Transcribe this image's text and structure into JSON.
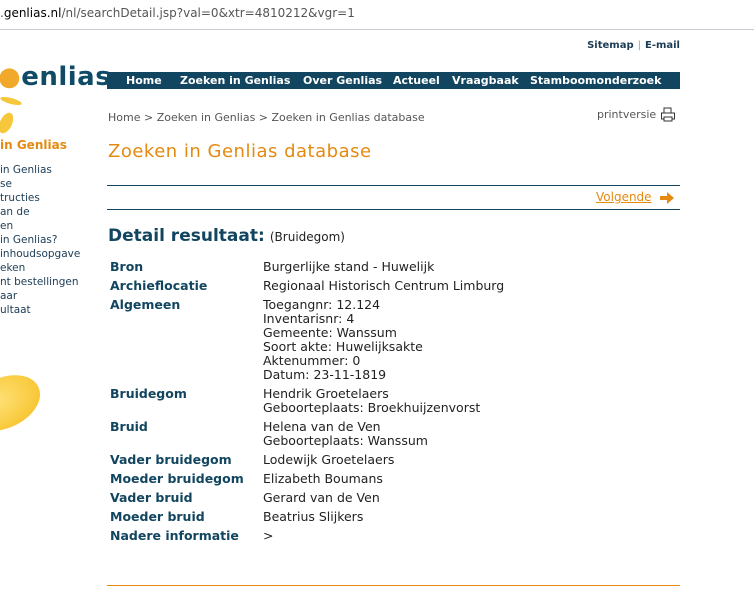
{
  "address": {
    "host": "genlias.nl",
    "prefix": ".",
    "path": "/nl/searchDetail.jsp?val=0&xtr=4810212&vgr=1"
  },
  "logo": "enlias",
  "sidebar": {
    "title": "in Genlias",
    "items": [
      "in Genlias",
      "se",
      "tructies",
      "an de",
      "en",
      "in Genlias?",
      "inhoudsopgave",
      "eken",
      "nt bestellingen",
      "aar",
      "ultaat"
    ]
  },
  "toplinks": {
    "sitemap": "Sitemap",
    "email": "E-mail"
  },
  "nav": [
    "Home",
    "Zoeken in Genlias",
    "Over Genlias",
    "Actueel",
    "Vraagbaak",
    "Stamboomonderzoek"
  ],
  "breadcrumb": "Home  >  Zoeken in Genlias  >  Zoeken in Genlias database",
  "print_label": "printversie",
  "page_title": "Zoeken in Genlias database",
  "next_label": "Volgende",
  "detail": {
    "heading": "Detail resultaat:",
    "sub": "(Bruidegom)"
  },
  "rows": [
    {
      "key": "Bron",
      "values": [
        "Burgerlijke stand - Huwelijk"
      ]
    },
    {
      "key": "Archieflocatie",
      "values": [
        "Regionaal Historisch Centrum Limburg"
      ]
    },
    {
      "key": "Algemeen",
      "values": [
        "Toegangnr: 12.124",
        "Inventarisnr: 4",
        "Gemeente: Wanssum",
        "Soort akte: Huwelijksakte",
        "Aktenummer: 0",
        "Datum: 23-11-1819"
      ]
    },
    {
      "key": "Bruidegom",
      "values": [
        "Hendrik Groetelaers",
        "Geboorteplaats: Broekhuijzenvorst"
      ]
    },
    {
      "key": "Bruid",
      "values": [
        "Helena van de Ven",
        "Geboorteplaats: Wanssum"
      ]
    },
    {
      "key": "Vader bruidegom",
      "values": [
        "Lodewijk Groetelaers"
      ]
    },
    {
      "key": "Moeder bruidegom",
      "values": [
        "Elizabeth Boumans"
      ]
    },
    {
      "key": "Vader bruid",
      "values": [
        "Gerard van de Ven"
      ]
    },
    {
      "key": "Moeder bruid",
      "values": [
        "Beatrius Slijkers"
      ]
    },
    {
      "key": "Nadere informatie",
      "values": [
        ">"
      ]
    }
  ],
  "colors": {
    "navy": "#12455f",
    "orange": "#e58a10",
    "sun": "#f6c73a"
  }
}
